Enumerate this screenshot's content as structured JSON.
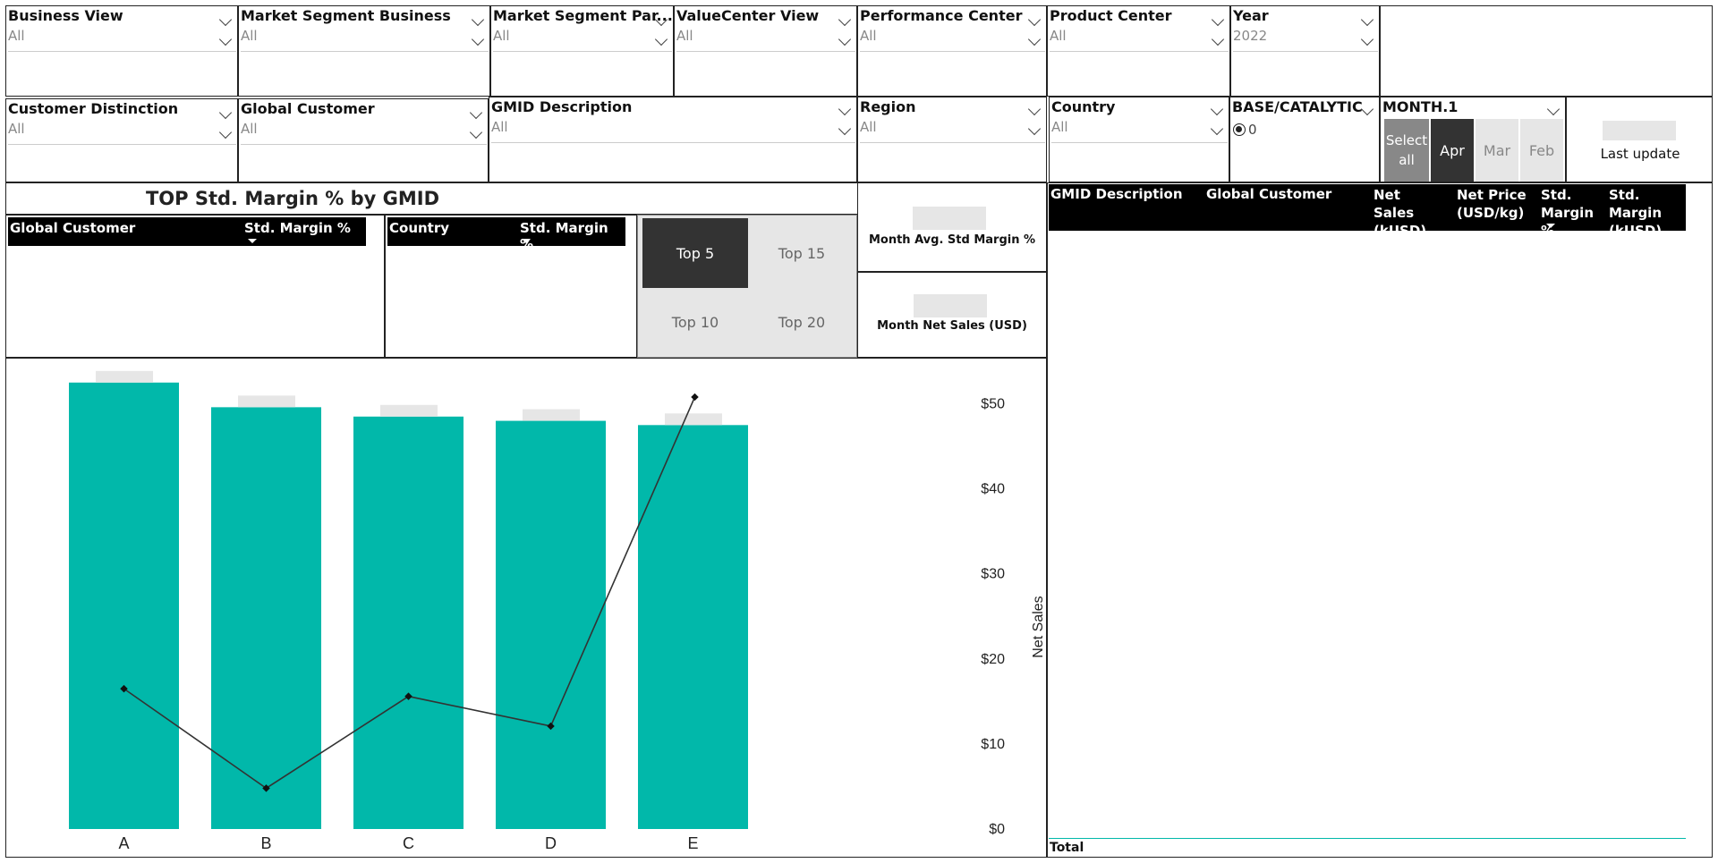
{
  "filters_row1": [
    {
      "title": "Business View",
      "value": "All"
    },
    {
      "title": "Market Segment Business",
      "value": "All"
    },
    {
      "title": "Market Segment Par...",
      "value": "All"
    },
    {
      "title": "ValueCenter View",
      "value": "All"
    },
    {
      "title": "Performance Center",
      "value": "All"
    },
    {
      "title": "Product Center",
      "value": "All"
    },
    {
      "title": "Year",
      "value": "2022"
    }
  ],
  "filters_row2": [
    {
      "title": "Customer Distinction",
      "value": "All"
    },
    {
      "title": "Global Customer",
      "value": "All"
    },
    {
      "title": "GMID Description",
      "value": "All"
    },
    {
      "title": "Region",
      "value": "All"
    },
    {
      "title": "Country",
      "value": "All"
    }
  ],
  "base_catalytic": {
    "title": "BASE/CATALYTIC",
    "option": "0"
  },
  "month": {
    "title": "MONTH.1",
    "buttons": [
      "Select all",
      "Apr",
      "Mar",
      "Feb"
    ],
    "selected": "Apr"
  },
  "last_update": {
    "label": "Last update"
  },
  "top_section": {
    "title": "TOP Std. Margin % by GMID"
  },
  "global_customer_table": {
    "col1": "Global Customer",
    "col2": "Std. Margin %"
  },
  "country_table": {
    "col1": "Country",
    "col2": "Std. Margin %"
  },
  "top_n": {
    "options": [
      "Top 5",
      "Top 15",
      "Top 10",
      "Top 20"
    ],
    "selected": "Top 5"
  },
  "kpis": {
    "avg_margin_label": "Month Avg. Std Margin %",
    "net_sales_label": "Month Net Sales (USD)"
  },
  "detail_table": {
    "headers": [
      "GMID Description",
      "Global Customer",
      "Net Sales (kUSD)",
      "Net Price (USD/kg)",
      "Std. Margin %",
      "Std. Margin (kUSD)"
    ],
    "total_label": "Total"
  },
  "colors": {
    "bar": "#01b8aa",
    "header": "#000000",
    "placeholder": "#e6e6e6"
  },
  "chart_data": {
    "type": "bar",
    "categories": [
      "A",
      "B",
      "C",
      "D",
      "E"
    ],
    "series": [
      {
        "type": "bar",
        "values": [
          52.5,
          49.6,
          48.5,
          48.0,
          47.5
        ]
      },
      {
        "type": "line",
        "values": [
          16.5,
          4.8,
          15.6,
          12.1,
          50.8
        ]
      }
    ],
    "ylabel": "Net Sales",
    "yticks": [
      "$0",
      "$10",
      "$20",
      "$30",
      "$40",
      "$50"
    ],
    "ylim": [
      0,
      55
    ]
  }
}
